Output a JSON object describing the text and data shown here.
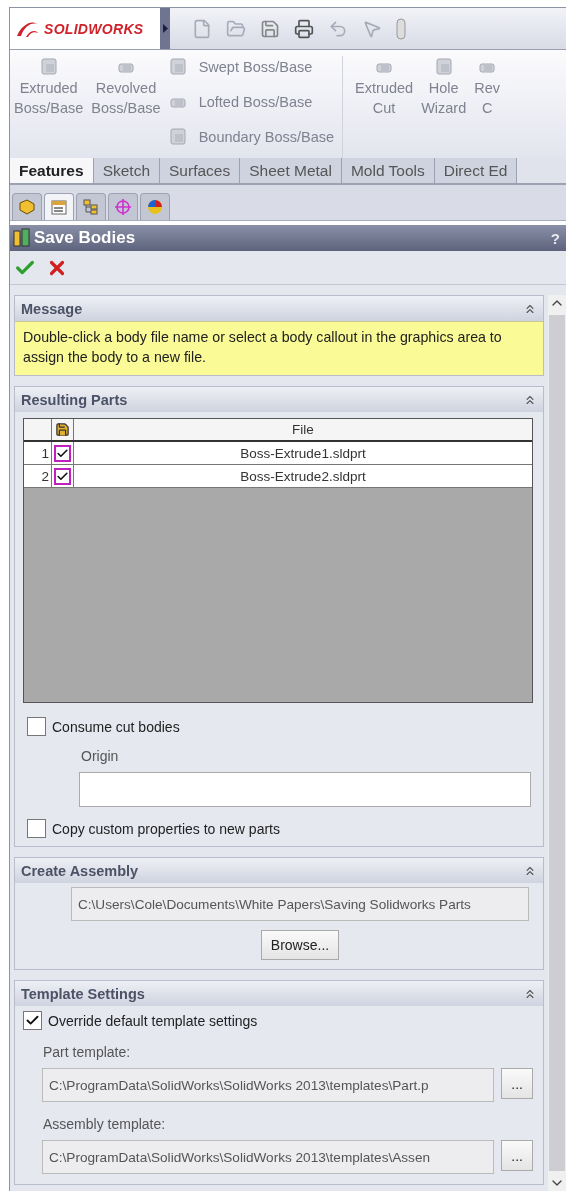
{
  "app": {
    "logo": "SOLIDWORKS"
  },
  "ribbon": {
    "large_buttons": [
      {
        "lines": [
          "Extruded",
          "Boss/Base"
        ],
        "disabled": true
      },
      {
        "lines": [
          "Revolved",
          "Boss/Base"
        ],
        "disabled": true
      }
    ],
    "small_buttons": [
      {
        "label": "Swept Boss/Base",
        "disabled": true
      },
      {
        "label": "Lofted Boss/Base",
        "disabled": true
      },
      {
        "label": "Boundary Boss/Base",
        "disabled": true
      }
    ],
    "cut_buttons": [
      {
        "lines": [
          "Extruded",
          "Cut"
        ],
        "disabled": true
      },
      {
        "lines": [
          "Hole",
          "Wizard"
        ],
        "disabled": true
      },
      {
        "lines": [
          "Rev",
          "C"
        ],
        "disabled": true
      }
    ]
  },
  "command_tabs": [
    {
      "label": "Features",
      "selected": true
    },
    {
      "label": "Sketch",
      "selected": false
    },
    {
      "label": "Surfaces",
      "selected": false
    },
    {
      "label": "Sheet Metal",
      "selected": false
    },
    {
      "label": "Mold Tools",
      "selected": false
    },
    {
      "label": "Direct Ed",
      "selected": false
    }
  ],
  "manager_tabs": [
    {
      "kind": "feature",
      "selected": false
    },
    {
      "kind": "property",
      "selected": true
    },
    {
      "kind": "config",
      "selected": false
    },
    {
      "kind": "target",
      "selected": false
    },
    {
      "kind": "display",
      "selected": false
    }
  ],
  "property_manager": {
    "title": "Save Bodies",
    "help": "?",
    "sections": [
      {
        "kind": "message",
        "title": "Message",
        "text": "Double-click a body file name or select a body callout in the graphics area to assign the body to a new file."
      },
      {
        "kind": "parts",
        "title": "Resulting Parts",
        "columns": [
          "File"
        ],
        "rows": [
          {
            "number": "1",
            "checked": true,
            "file": "Boss-Extrude1.sldprt"
          },
          {
            "number": "2",
            "checked": true,
            "file": "Boss-Extrude2.sldprt"
          }
        ],
        "consume": {
          "label": "Consume cut bodies",
          "checked": false
        },
        "origin_label": "Origin",
        "copy": {
          "label": "Copy custom properties to new parts",
          "checked": false
        }
      },
      {
        "kind": "assembly",
        "title": "Create Assembly",
        "path": "C:\\Users\\Cole\\Documents\\White Papers\\Saving Solidworks Parts",
        "button": "Browse..."
      },
      {
        "kind": "template",
        "title": "Template Settings",
        "override": {
          "label": "Override default template settings",
          "checked": true
        },
        "fields": [
          {
            "label": "Part template:",
            "value": "C:\\ProgramData\\SolidWorks\\SolidWorks 2013\\templates\\Part.p",
            "button": "..."
          },
          {
            "label": "Assembly template:",
            "value": "C:\\ProgramData\\SolidWorks\\SolidWorks 2013\\templates\\Assen",
            "button": "..."
          }
        ]
      }
    ]
  }
}
